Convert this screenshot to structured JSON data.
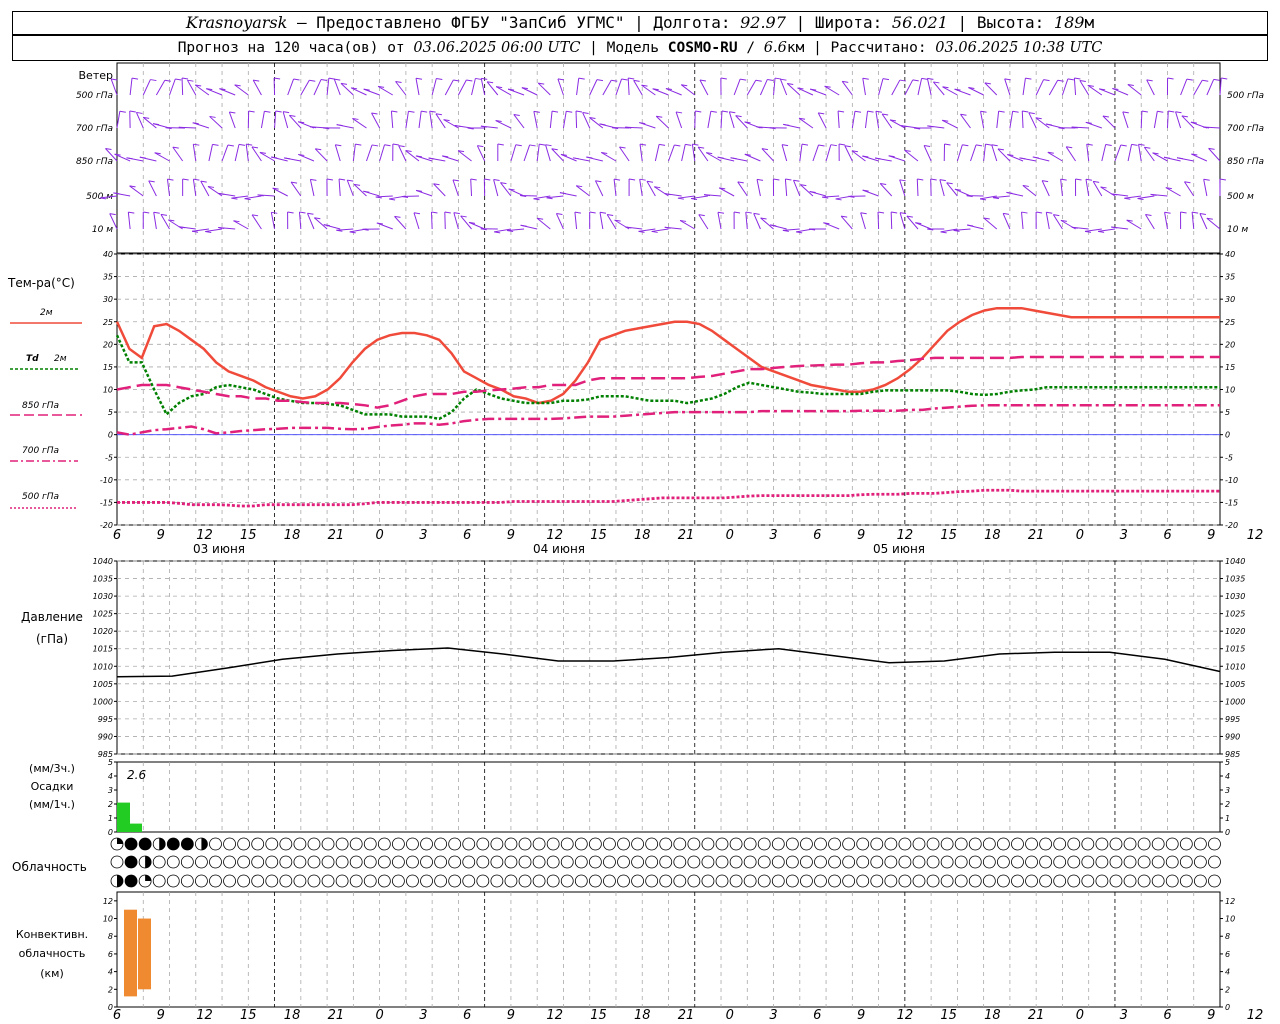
{
  "header": {
    "station": "Krasnoyarsk",
    "dash": "–",
    "provider": "Предоставлено ФГБУ \"ЗапСиб УГМС\"",
    "lon_label": "Долгота:",
    "lon": "92.97",
    "lat_label": "Широта:",
    "lat": "56.021",
    "alt_label": "Высота:",
    "alt": "189",
    "alt_unit": "м",
    "sep": "|"
  },
  "subheader": {
    "forecast_prefix": "Прогноз на 120 часа(ов) от",
    "forecast_time": "03.06.2025 06:00 UTC",
    "model_label": "Модель",
    "model": "COSMO-RU",
    "resolution_sep": "/",
    "resolution": "6.6",
    "resolution_unit": "км",
    "calc_label": "Рассчитано:",
    "calc_time": "03.06.2025 10:38 UTC",
    "sep": "|"
  },
  "labels": {
    "wind": "Ветер",
    "wind_levels": [
      "500 гПа",
      "700 гПа",
      "850 гПа",
      "500 м",
      "10 м"
    ],
    "temp_title": "Тем-ра(°C)",
    "t2m": "2м",
    "td": "Td",
    "td_level": "2м",
    "t850": "850 гПа",
    "t700": "700 гПа",
    "t500": "500 гПа",
    "pressure": "Давление",
    "pressure_unit": "(гПа)",
    "precip_unit_3h": "(мм/3ч.)",
    "precip": "Осадки",
    "precip_unit_1h": "(мм/1ч.)",
    "precip_max": "2.6",
    "cloud": "Облачность",
    "conv1": "Конвективн.",
    "conv2": "облачность",
    "conv3": "(км)"
  },
  "colors": {
    "wind": "#8a2be2",
    "t2m": "#f04a3a",
    "td": "#008000",
    "t850": "#e0207a",
    "t700": "#e0207a",
    "t500": "#e0207a",
    "zero_line": "#4040ff",
    "pressure": "#000000",
    "precip": "#22cc22",
    "convective": "#f08a30",
    "grid": "#aaaaaa"
  },
  "chart_data": [
    {
      "type": "wind_barbs",
      "levels": [
        "500 гПа",
        "700 гПа",
        "850 гПа",
        "500 м",
        "10 м"
      ],
      "note_calm_symbols_at_700hPa": [
        "04 июня 00 UTC",
        "05 июня 00 UTC"
      ]
    },
    {
      "type": "line",
      "ylim": [
        -20,
        40
      ],
      "yticks": [
        -20,
        -15,
        -10,
        -5,
        0,
        5,
        10,
        15,
        20,
        25,
        30,
        35,
        40
      ],
      "x_tick_labels": [
        "6",
        "9",
        "12",
        "15",
        "18",
        "21",
        "0",
        "3",
        "6",
        "9",
        "12",
        "15",
        "18",
        "21",
        "0",
        "3",
        "6",
        "9",
        "12",
        "15",
        "18",
        "21",
        "0",
        "3",
        "6",
        "9",
        "12"
      ],
      "day_labels": [
        "03 июня",
        "04 июня",
        "05 июня"
      ],
      "x_hours": [
        0,
        2,
        4,
        6,
        8,
        10,
        12,
        14,
        16,
        18,
        20,
        22,
        24,
        26,
        28,
        30,
        32,
        34,
        36,
        38,
        40,
        42,
        44,
        46,
        48,
        50,
        52,
        54,
        56,
        58,
        60,
        62,
        64,
        66,
        68,
        70,
        72,
        74,
        76,
        78
      ],
      "series": [
        {
          "name": "2м",
          "values": [
            25,
            19,
            17,
            24,
            24.5,
            23,
            21,
            19,
            16,
            14,
            13,
            12,
            10.5,
            9.5,
            8.5,
            8,
            8.5,
            10,
            12.5,
            16,
            19,
            21,
            22,
            22.5,
            22.5,
            22,
            21,
            18,
            14,
            12.5,
            11,
            10,
            8.5,
            8,
            7,
            7.5,
            9,
            12,
            16,
            21
          ]
        },
        {
          "name": "Td 2м",
          "values": [
            22,
            16,
            16,
            10,
            4.5,
            7,
            8.5,
            9,
            10.5,
            11,
            10.5,
            10,
            9,
            8,
            7.5,
            7,
            7,
            6.8,
            6.5,
            5.5,
            4.5,
            4.5,
            4.5,
            4,
            4,
            4,
            3.5,
            5,
            8,
            10,
            9,
            8,
            7.5,
            7,
            7,
            7,
            7.5,
            7.5,
            7.8,
            8.5
          ]
        },
        {
          "name": "850 гПа",
          "values": [
            10,
            10.5,
            11,
            11,
            11,
            10.5,
            10,
            9.5,
            9,
            8.5,
            8.5,
            8,
            8,
            7.5,
            7.5,
            7.2,
            7,
            7,
            7,
            6.8,
            6.5,
            6,
            6.5,
            7.5,
            8.5,
            9,
            9,
            9,
            9.5,
            9.5,
            9.8,
            10,
            10.2,
            10.5,
            10.5,
            11,
            11,
            11,
            12,
            12.5
          ]
        },
        {
          "name": "700 гПа",
          "values": [
            0.5,
            0,
            0.5,
            1,
            1.2,
            1.5,
            1.8,
            1.2,
            0.3,
            0.5,
            0.8,
            1,
            1.2,
            1.3,
            1.5,
            1.5,
            1.5,
            1.5,
            1.3,
            1.2,
            1.3,
            1.7,
            2,
            2.2,
            2.5,
            2.5,
            2.2,
            2.5,
            3,
            3.3,
            3.5,
            3.5,
            3.5,
            3.5,
            3.5,
            3.5,
            3.6,
            3.8,
            4,
            4
          ]
        },
        {
          "name": "500 гПа",
          "values": [
            -15,
            -15,
            -15,
            -15,
            -15,
            -15.2,
            -15.5,
            -15.5,
            -15.5,
            -15.6,
            -15.8,
            -15.8,
            -15.5,
            -15.5,
            -15.5,
            -15.5,
            -15.5,
            -15.5,
            -15.5,
            -15.5,
            -15.3,
            -15,
            -15,
            -15,
            -15,
            -15,
            -15,
            -15,
            -15,
            -15,
            -15,
            -15,
            -14.8,
            -14.8,
            -14.8,
            -14.8,
            -14.8,
            -14.8,
            -14.8,
            -14.8
          ]
        }
      ],
      "x_hours_2": [
        80,
        82,
        84,
        86,
        88,
        90,
        92,
        94,
        96,
        98,
        100,
        102,
        104,
        106,
        108,
        110,
        112,
        114,
        116,
        118,
        120,
        122,
        124,
        126,
        128,
        130,
        132,
        134,
        136,
        138,
        140,
        142,
        144,
        146,
        148,
        150,
        152,
        154,
        156,
        158,
        160,
        162,
        164,
        166,
        168,
        170,
        172,
        174,
        176,
        178
      ],
      "series_2": [
        {
          "name": "2м",
          "values": [
            22,
            23,
            23.5,
            24,
            24.5,
            25,
            25,
            24.5,
            23,
            21,
            19,
            17,
            15,
            14,
            13,
            12,
            11,
            10.5,
            10,
            9.5,
            9.5,
            10,
            11,
            12.5,
            14.5,
            17,
            20,
            23,
            25,
            26.5,
            27.5,
            28,
            28,
            28,
            27.5,
            27,
            26.5,
            26,
            26,
            26,
            26,
            26,
            26,
            26,
            26,
            26,
            26,
            26,
            26,
            26
          ]
        },
        {
          "name": "Td 2м",
          "values": [
            8.5,
            8.5,
            8,
            7.5,
            7.5,
            7.5,
            7,
            7.5,
            8,
            9,
            10.5,
            11.5,
            11,
            10.5,
            10,
            9.5,
            9.3,
            9,
            9,
            9,
            9,
            9.5,
            9.8,
            9.8,
            9.8,
            9.8,
            9.8,
            9.8,
            9.5,
            9,
            8.8,
            9,
            9.5,
            9.8,
            10,
            10.5,
            10.5,
            10.5,
            10.5,
            10.5,
            10.5,
            10.5,
            10.5,
            10.5,
            10.5,
            10.5,
            10.5,
            10.5,
            10.5,
            10.5
          ]
        },
        {
          "name": "850 гПа",
          "values": [
            12.5,
            12.5,
            12.5,
            12.5,
            12.5,
            12.5,
            12.5,
            12.8,
            13,
            13.5,
            14,
            14.5,
            14.5,
            14.8,
            15,
            15.2,
            15.3,
            15.4,
            15.5,
            15.5,
            15.8,
            16,
            16,
            16.3,
            16.5,
            16.8,
            17,
            17,
            17,
            17,
            17,
            17,
            17,
            17.2,
            17.2,
            17.2,
            17.2,
            17.2,
            17.2,
            17.2,
            17.2,
            17.2,
            17.2,
            17.2,
            17.2,
            17.2,
            17.2,
            17.2,
            17.2,
            17.2
          ]
        },
        {
          "name": "700 гПа",
          "values": [
            4,
            4.2,
            4.4,
            4.6,
            4.8,
            5,
            5,
            5,
            5,
            5,
            5,
            5,
            5.2,
            5.2,
            5.2,
            5.2,
            5.2,
            5.2,
            5.2,
            5.2,
            5.3,
            5.3,
            5.3,
            5.3,
            5.5,
            5.5,
            5.8,
            6,
            6.2,
            6.4,
            6.5,
            6.5,
            6.5,
            6.5,
            6.5,
            6.5,
            6.5,
            6.5,
            6.5,
            6.5,
            6.5,
            6.5,
            6.5,
            6.5,
            6.5,
            6.5,
            6.5,
            6.5,
            6.5,
            6.5
          ]
        },
        {
          "name": "500 гПа",
          "values": [
            -14.8,
            -14.6,
            -14.4,
            -14.2,
            -14,
            -14,
            -14,
            -14,
            -14,
            -14,
            -13.8,
            -13.6,
            -13.5,
            -13.5,
            -13.5,
            -13.5,
            -13.5,
            -13.5,
            -13.5,
            -13.5,
            -13.3,
            -13.2,
            -13.2,
            -13.2,
            -13,
            -13,
            -13,
            -12.8,
            -12.6,
            -12.5,
            -12.3,
            -12.3,
            -12.3,
            -12.5,
            -12.5,
            -12.5,
            -12.5,
            -12.5,
            -12.5,
            -12.5,
            -12.5,
            -12.5,
            -12.5,
            -12.5,
            -12.5,
            -12.5,
            -12.5,
            -12.5,
            -12.5,
            -12.5
          ]
        }
      ]
    },
    {
      "type": "line",
      "ylim": [
        985,
        1040
      ],
      "yticks": [
        985,
        990,
        995,
        1000,
        1005,
        1010,
        1015,
        1020,
        1025,
        1030,
        1035,
        1040
      ],
      "x_hours": [
        0,
        6,
        12,
        18,
        24,
        30,
        36,
        42,
        48,
        54,
        60,
        66,
        72,
        78,
        84,
        90,
        96,
        102,
        108,
        114,
        120
      ],
      "series": [
        {
          "name": "Давление",
          "values": [
            1007,
            1007.2,
            1009.5,
            1012,
            1013.5,
            1014.5,
            1015.2,
            1013.5,
            1011.5,
            1011.5,
            1012.5,
            1014,
            1015,
            1013,
            1011,
            1011.5,
            1013.5,
            1014,
            1014,
            1012,
            1008.5
          ]
        }
      ]
    },
    {
      "type": "bar",
      "ylim": [
        0,
        5
      ],
      "yticks": [
        0,
        1,
        2,
        3,
        4,
        5
      ],
      "x_hours": [
        6,
        7,
        8
      ],
      "values": [
        2.1,
        2.1,
        0.6
      ],
      "max_label": "2.6"
    },
    {
      "type": "cloud_cover",
      "rows": 3,
      "step_hours": 1,
      "values_okta": [
        [
          2,
          8,
          8,
          6,
          8,
          8,
          5,
          0,
          0,
          0,
          0,
          0,
          0,
          0,
          0,
          0,
          0,
          0,
          0,
          0,
          0,
          0,
          0,
          0,
          0,
          0,
          0,
          0,
          0,
          0,
          0,
          0,
          0,
          0,
          0,
          0,
          0,
          0,
          0,
          0,
          0,
          0,
          0,
          0,
          0,
          0,
          0,
          0,
          0,
          0,
          0,
          0,
          0,
          0,
          0,
          0,
          0,
          0,
          0,
          0,
          0,
          0,
          0,
          0,
          0,
          0,
          0,
          0,
          0,
          0,
          0,
          0,
          0,
          0,
          0,
          0,
          0,
          0,
          0,
          0,
          0,
          0,
          0,
          0,
          0,
          0,
          0,
          0,
          0,
          0,
          0
        ],
        [
          0,
          8,
          6,
          0,
          0,
          0,
          0,
          0,
          0,
          0,
          0,
          0,
          0,
          0,
          0,
          0,
          0,
          0,
          0,
          0,
          0,
          0,
          0,
          0,
          0,
          0,
          0,
          0,
          0,
          0,
          0,
          0,
          0,
          0,
          0,
          0,
          0,
          0,
          0,
          0,
          0,
          0,
          0,
          0,
          0,
          0,
          0,
          0,
          0,
          0,
          0,
          0,
          0,
          0,
          0,
          0,
          0,
          0,
          0,
          0,
          0,
          0,
          0,
          0,
          0,
          0,
          0,
          0,
          0,
          0,
          0,
          0,
          0,
          0,
          0,
          0,
          0,
          0,
          0,
          0,
          0,
          0,
          0,
          0,
          0,
          0,
          0,
          0,
          0,
          0,
          0
        ],
        [
          6,
          8,
          1,
          0,
          0,
          0,
          0,
          0,
          0,
          0,
          0,
          0,
          0,
          0,
          0,
          0,
          0,
          0,
          0,
          0,
          0,
          0,
          0,
          0,
          0,
          0,
          0,
          0,
          0,
          0,
          0,
          0,
          0,
          0,
          0,
          0,
          0,
          0,
          0,
          0,
          0,
          0,
          0,
          0,
          0,
          0,
          0,
          0,
          0,
          0,
          0,
          0,
          0,
          0,
          0,
          0,
          0,
          0,
          0,
          0,
          0,
          0,
          0,
          0,
          0,
          0,
          0,
          0,
          0,
          0,
          0,
          0,
          0,
          0,
          0,
          0,
          0,
          0,
          0,
          0,
          0,
          0,
          0,
          0,
          0,
          0,
          0,
          0,
          0,
          0,
          0
        ]
      ]
    },
    {
      "type": "bar",
      "ylim": [
        0,
        13
      ],
      "yticks": [
        0,
        2,
        4,
        6,
        8,
        10,
        12
      ],
      "ranges_km": [
        {
          "x_hour": 7,
          "bottom": 1.2,
          "top": 11
        },
        {
          "x_hour": 8,
          "bottom": 2,
          "top": 10
        }
      ]
    }
  ]
}
